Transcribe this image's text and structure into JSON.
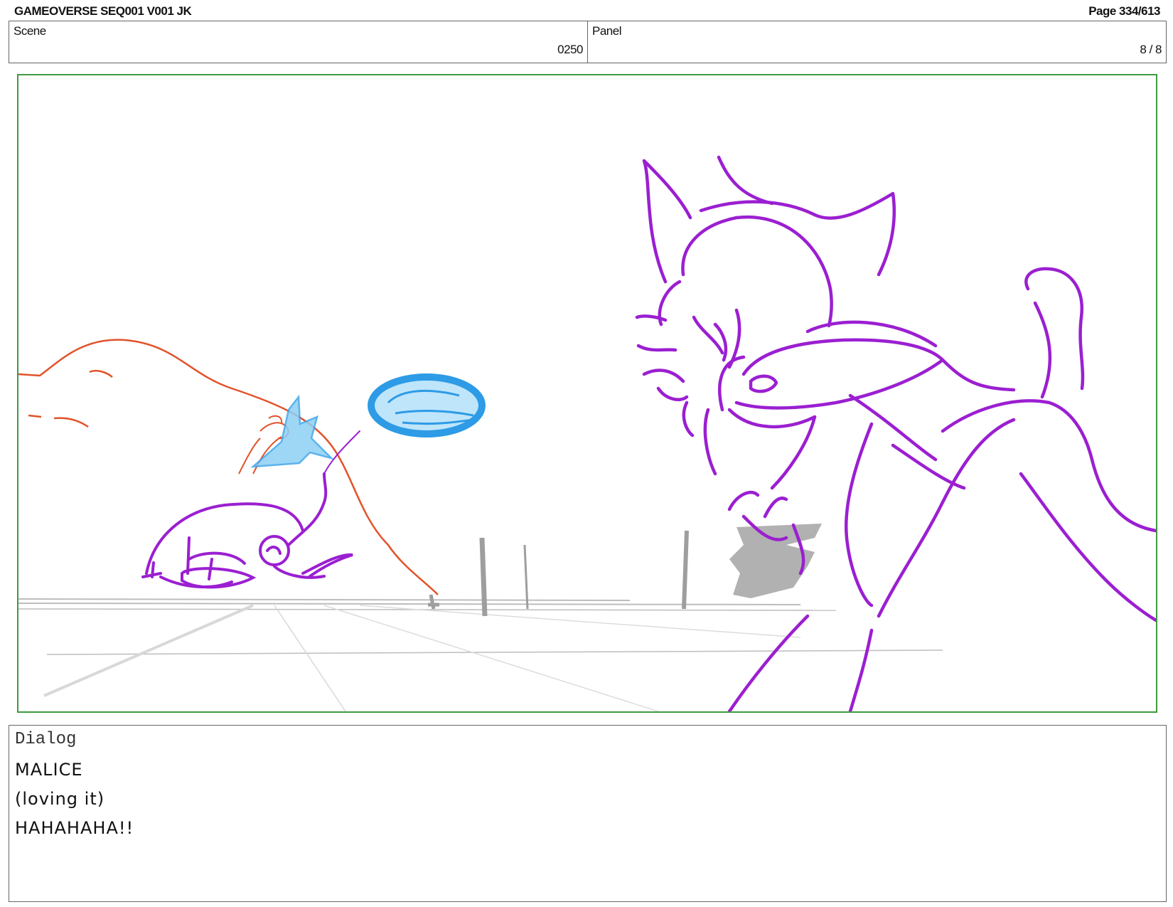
{
  "header": {
    "title": "GAMEOVERSE SEQ001 V001 JK",
    "page": "Page 334/613"
  },
  "scene": {
    "label": "Scene",
    "value": "0250"
  },
  "panel": {
    "label": "Panel",
    "value": "8 / 8"
  },
  "sketch": {
    "colors": {
      "frame_border": "#3f9a3f",
      "character_purple": "#9b1fd1",
      "effect_blue": "#3fa6ea",
      "swoosh_orange": "#e2522a",
      "ground_gray": "#bdbdbd"
    }
  },
  "dialog": {
    "label": "Dialog",
    "lines": [
      "MALICE",
      "(loving it)",
      "HAHAHAHA!!"
    ]
  }
}
